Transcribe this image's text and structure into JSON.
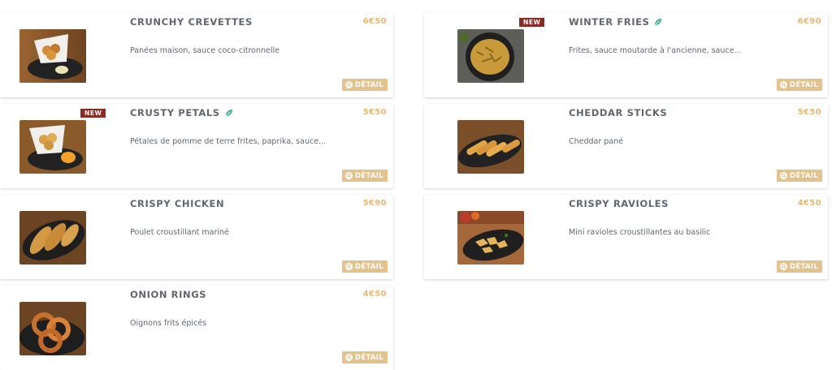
{
  "items": [
    {
      "title": "CRUNCHY CREVETTES",
      "price": "6€50",
      "description": "Panées maison, sauce coco-citronnelle",
      "detail_label": "DÉTAIL",
      "badge": "",
      "veggie": false
    },
    {
      "title": "WINTER FRIES",
      "price": "6€90",
      "description": "Frites, sauce moutarde à l'ancienne, sauce...",
      "detail_label": "DÉTAIL",
      "badge": "NEW",
      "veggie": true
    },
    {
      "title": "CRUSTY PETALS",
      "price": "5€50",
      "description": "Pétales de pomme de terre frites, paprika, sauce...",
      "detail_label": "DÉTAIL",
      "badge": "NEW",
      "veggie": true
    },
    {
      "title": "CHEDDAR STICKS",
      "price": "5€50",
      "description": "Cheddar pané",
      "detail_label": "DÉTAIL",
      "badge": "",
      "veggie": false
    },
    {
      "title": "CRISPY CHICKEN",
      "price": "5€90",
      "description": "Poulet croustillant mariné",
      "detail_label": "DÉTAIL",
      "badge": "",
      "veggie": false
    },
    {
      "title": "CRISPY RAVIOLES",
      "price": "4€50",
      "description": "Mini ravioles croustillantes au basilic",
      "detail_label": "DÉTAIL",
      "badge": "",
      "veggie": false
    },
    {
      "title": "ONION RINGS",
      "price": "4€50",
      "description": "Oignons frits épicés",
      "detail_label": "DÉTAIL",
      "badge": "",
      "veggie": false
    }
  ],
  "colors": {
    "price": "#e4b877",
    "detail_button": "#e4c28b",
    "badge": "#8b2b24",
    "title": "#5f6770",
    "leaf": "#3fb9a6"
  },
  "icons": {
    "detail": "magnifier-icon",
    "veggie": "leaf-icon"
  }
}
